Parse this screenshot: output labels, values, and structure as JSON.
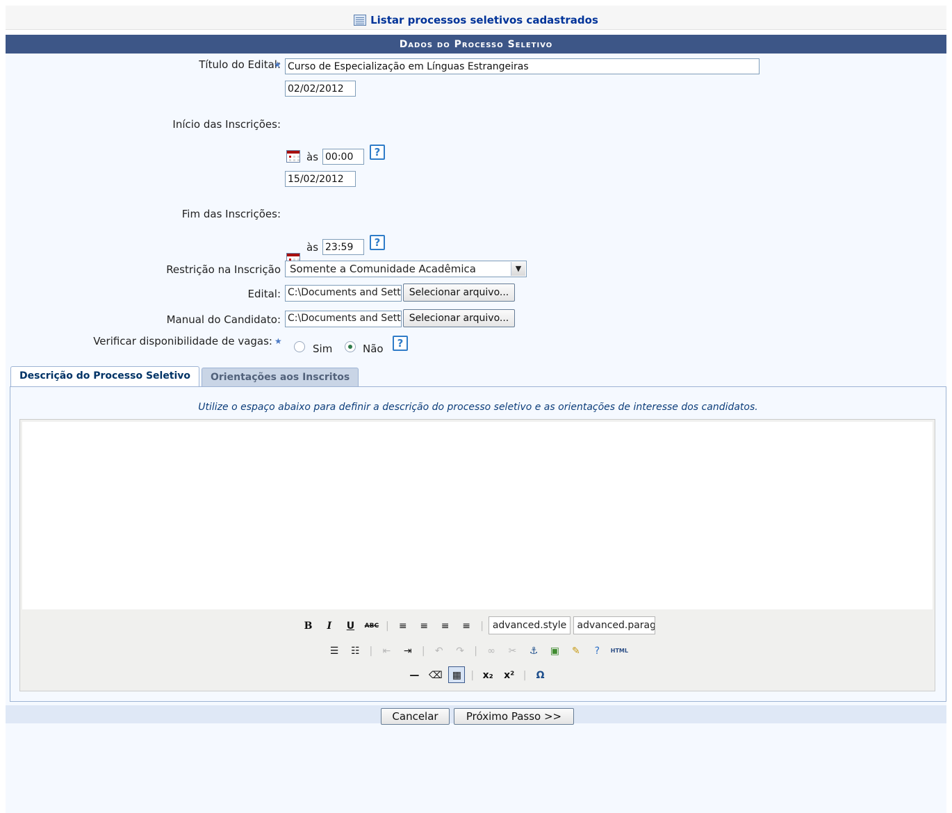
{
  "top_link": {
    "label": "Listar processos seletivos cadastrados"
  },
  "section_title": "Dados do Processo Seletivo",
  "form": {
    "titulo_label": "Título do Edital:",
    "titulo_value": "Curso de Especialização em Línguas Estrangeiras",
    "inicio_label": "Início das Inscrições:",
    "inicio_date": "02/02/2012",
    "inicio_time": "00:00",
    "fim_label": "Fim das Inscrições:",
    "fim_date": "15/02/2012",
    "fim_time": "23:59",
    "as_label": "às",
    "restricao_label": "Restrição na Inscrição",
    "restricao_value": "Somente a Comunidade Acadêmica",
    "edital_label": "Edital:",
    "edital_path": "C:\\Documents and Settings",
    "manual_label": "Manual do Candidato:",
    "manual_path": "C:\\Documents and Settings",
    "select_file_label": "Selecionar arquivo...",
    "vagas_label": "Verificar disponibilidade de vagas:",
    "sim_label": "Sim",
    "nao_label": "Não",
    "vagas_selected": "Não"
  },
  "tabs": [
    {
      "label": "Descrição do Processo Seletivo",
      "active": true
    },
    {
      "label": "Orientações aos Inscritos",
      "active": false
    }
  ],
  "editor": {
    "hint": "Utilize o espaço abaixo para definir a descrição do processo seletivo e as orientações de interesse dos candidatos.",
    "style_select": "advanced.style",
    "paragraph_select": "advanced.paragraph",
    "html_label": "HTML"
  },
  "buttons": {
    "cancel": "Cancelar",
    "next": "Próximo Passo >>"
  },
  "colors": {
    "header_bg": "#3d5687",
    "link": "#003399",
    "panel_bg": "#f5f9ff",
    "footer_bg": "#dfe8f6"
  }
}
